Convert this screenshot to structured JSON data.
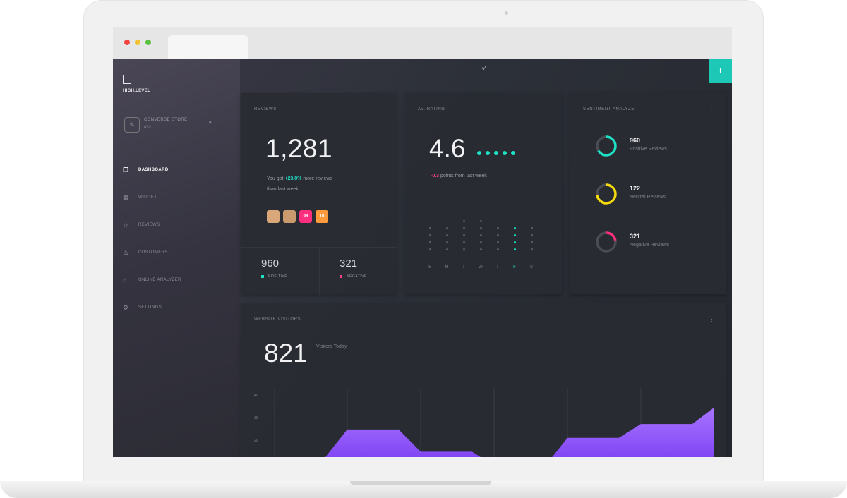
{
  "sidebar": {
    "logo_text": "HIGH.LEVEL",
    "store": {
      "name": "CONVERSE STORE",
      "number": "#32",
      "caret": "▾",
      "icon": "pencil-icon",
      "icon_glyph": "✎"
    },
    "items": [
      {
        "label": "DASHBOARD",
        "icon": "dashboard-icon",
        "glyph": "❐",
        "active": true
      },
      {
        "label": "WIDGET",
        "icon": "widget-icon",
        "glyph": "▦",
        "active": false
      },
      {
        "label": "REVIEWS",
        "icon": "star-icon",
        "glyph": "☆",
        "active": false
      },
      {
        "label": "CUSTOMERS",
        "icon": "user-icon",
        "glyph": "♙",
        "active": false
      },
      {
        "label": "ONLINE ANALYZER",
        "icon": "thumb-icon",
        "glyph": "☝",
        "active": false
      },
      {
        "label": "SETTINGS",
        "icon": "gear-icon",
        "glyph": "⚙",
        "active": false
      }
    ]
  },
  "topbar": {
    "center_icon": "⁴⁄",
    "add_button": "+"
  },
  "reviews_card": {
    "title": "REVIEWS",
    "value": "1,281",
    "sub_prefix": "You got ",
    "sub_highlight": "+23.8%",
    "sub_suffix": " more reviews",
    "sub_line2": "than last week",
    "badges": [
      {
        "name": "avatar-one",
        "text": "",
        "color": "#d9a77a"
      },
      {
        "name": "avatar-two",
        "text": "",
        "color": "#c99a6e"
      },
      {
        "name": "badge-pink",
        "text": "98",
        "color": "#ff2e7e"
      },
      {
        "name": "badge-orange",
        "text": "10",
        "color": "#ff9b3d"
      }
    ],
    "positive": {
      "value": "960",
      "label": "POSITIVE",
      "color": "#1ee0c5"
    },
    "negative": {
      "value": "321",
      "label": "NEGATIVE",
      "color": "#ff3f8a"
    }
  },
  "rating_card": {
    "title": "AV. RATING",
    "value": "4.6",
    "stars": 5,
    "sub_value": "-0.3",
    "sub_text": " points from last week",
    "days": [
      "S",
      "M",
      "T",
      "W",
      "T",
      "F",
      "S"
    ],
    "active_day": 5,
    "day_levels": [
      4,
      4,
      5,
      5,
      4,
      4,
      4
    ],
    "active_level": 4
  },
  "sentiment_card": {
    "title": "SENTIMENT ANALYZE",
    "rows": [
      {
        "value": "960",
        "label": "Positive Reviews",
        "color": "#1ee0c5",
        "fraction": 0.66
      },
      {
        "value": "122",
        "label": "Neutral Reviews",
        "color": "#f5d90a",
        "fraction": 0.72
      },
      {
        "value": "321",
        "label": "Negative Reviews",
        "color": "#ff2e7e",
        "fraction": 0.22
      }
    ]
  },
  "visitors_card": {
    "title": "WEBSITE VISITORS",
    "value": "821",
    "sub": "Visitors Today",
    "y_ticks": [
      "40",
      "30",
      "20"
    ],
    "accent": "#9b5cff"
  },
  "chart_data": {
    "type": "area",
    "x": [
      0,
      1,
      2,
      3,
      4,
      5,
      6
    ],
    "values": [
      20,
      30,
      22,
      17,
      27,
      32,
      38
    ],
    "ylabel": "",
    "ylim": [
      17,
      45
    ],
    "grid": true
  }
}
